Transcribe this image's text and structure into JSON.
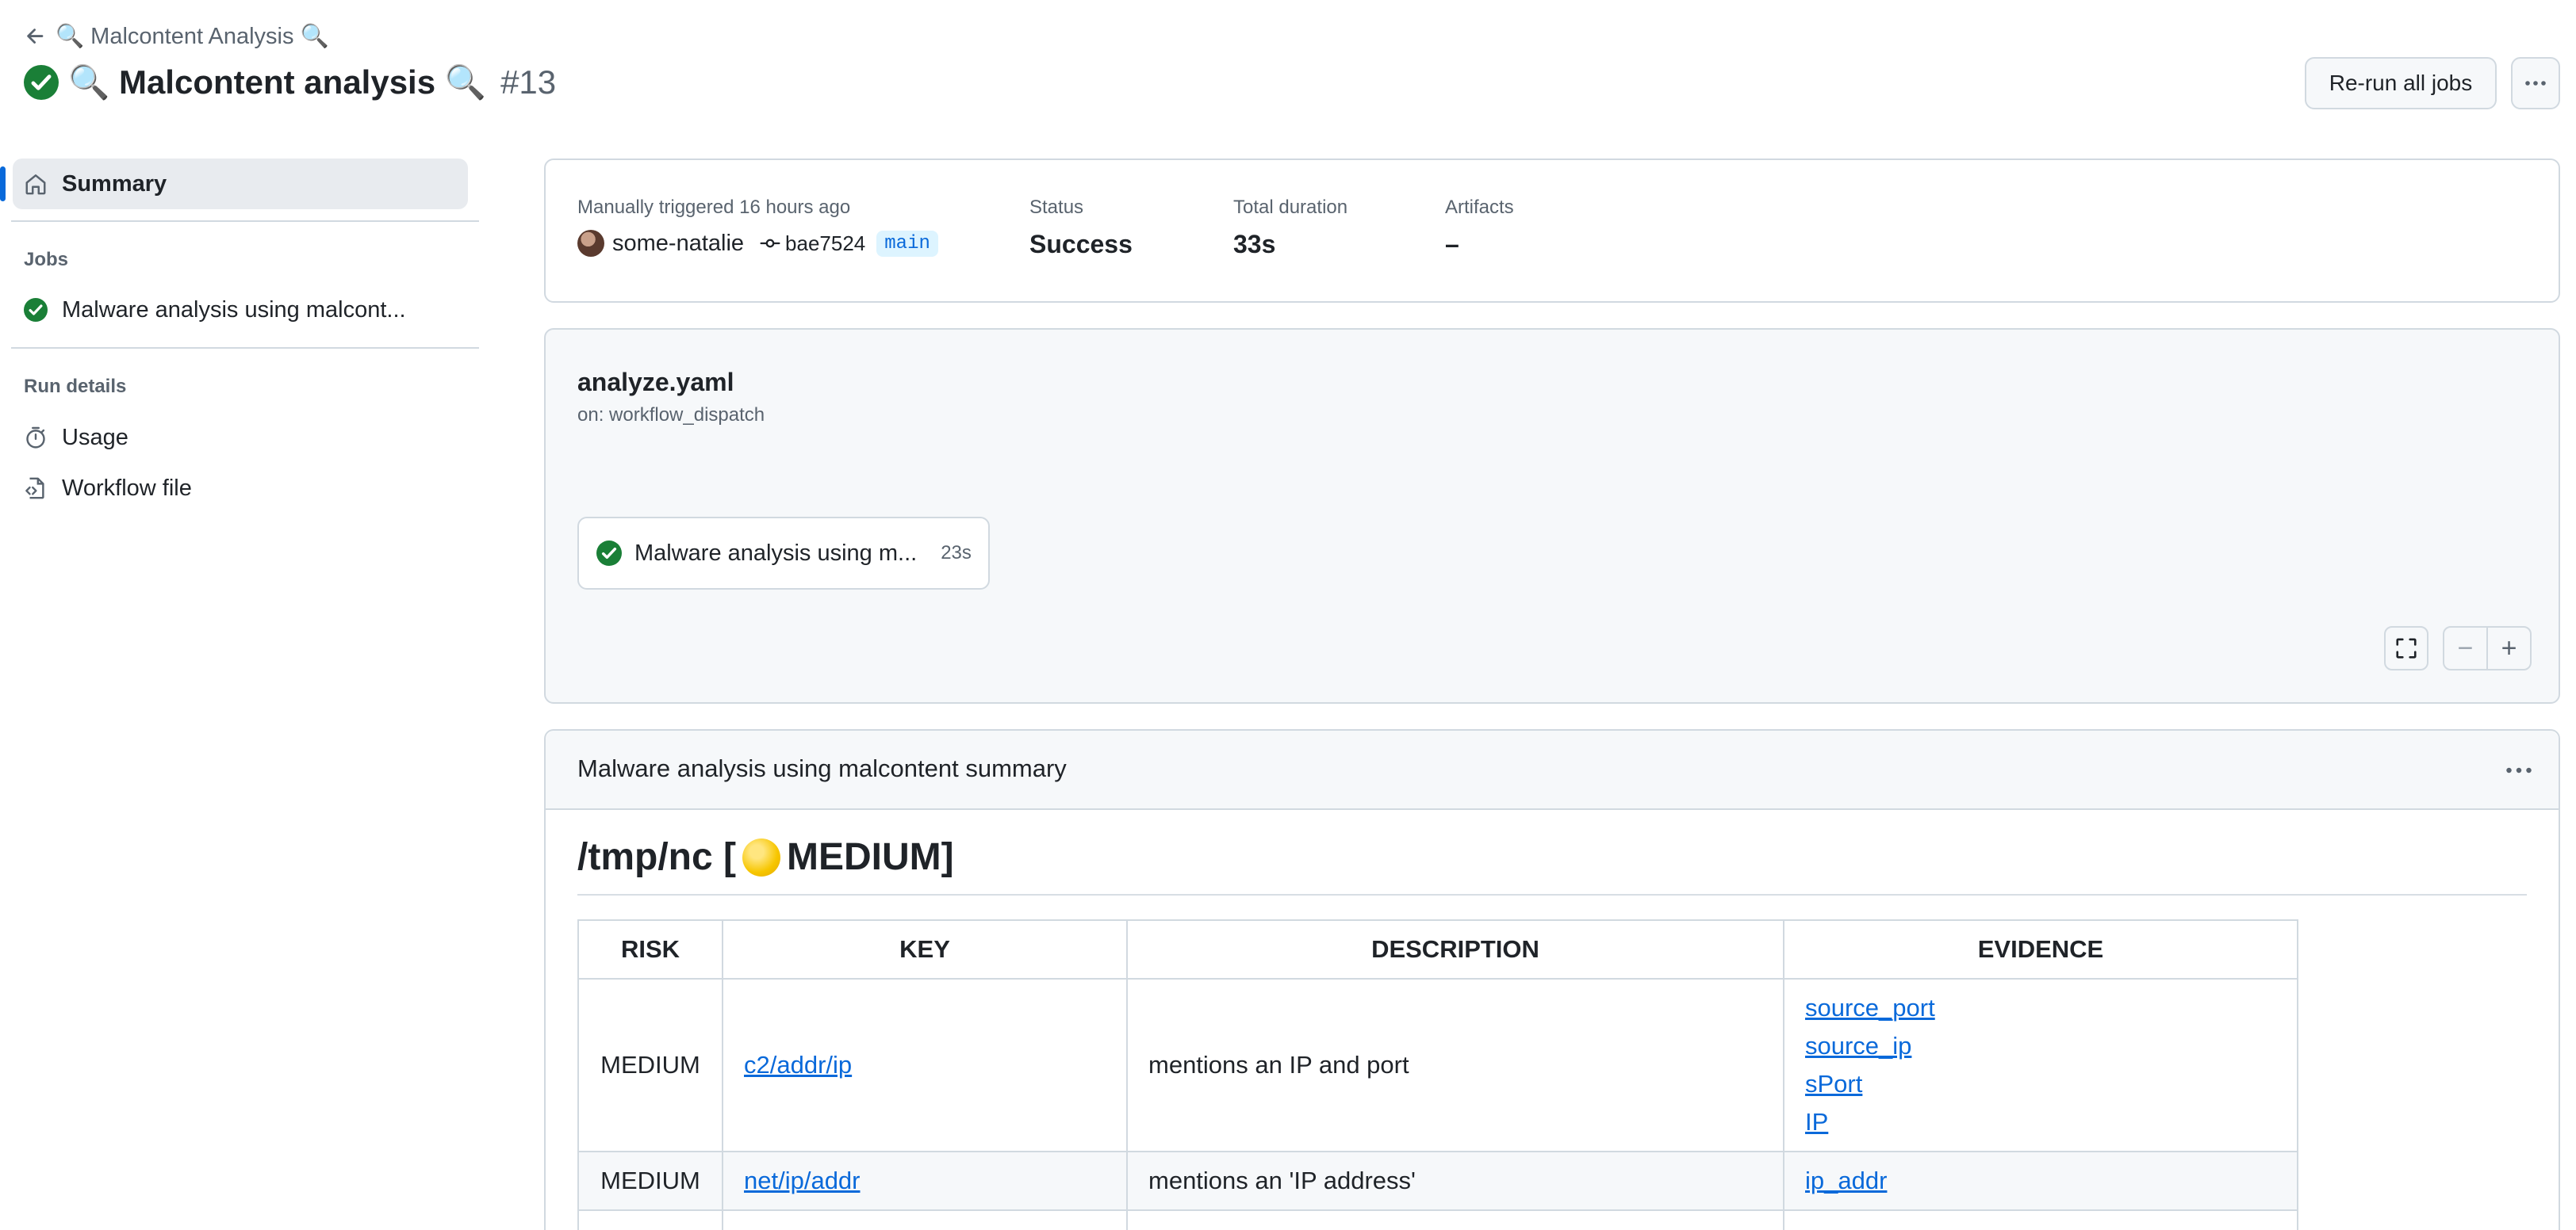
{
  "breadcrumb": {
    "back_label": "🔍 Malcontent Analysis 🔍"
  },
  "header": {
    "title": "🔍 Malcontent analysis 🔍",
    "run_number": "#13",
    "rerun_label": "Re-run all jobs"
  },
  "sidebar": {
    "summary_label": "Summary",
    "jobs_heading": "Jobs",
    "job_label": "Malware analysis using malcont...",
    "run_details_heading": "Run details",
    "usage_label": "Usage",
    "workflow_file_label": "Workflow file"
  },
  "run_info": {
    "trigger_text": "Manually triggered 16 hours ago",
    "actor": "some-natalie",
    "commit": "bae7524",
    "branch": "main",
    "status_label": "Status",
    "status_value": "Success",
    "duration_label": "Total duration",
    "duration_value": "33s",
    "artifacts_label": "Artifacts",
    "artifacts_value": "–"
  },
  "workflow": {
    "file_name": "analyze.yaml",
    "trigger": "on: workflow_dispatch",
    "job_name": "Malware analysis using m...",
    "job_duration": "23s"
  },
  "summary": {
    "title": "Malware analysis using malcontent summary",
    "file_path": "/tmp/nc [",
    "file_level": "MEDIUM]",
    "columns": [
      "RISK",
      "KEY",
      "DESCRIPTION",
      "EVIDENCE"
    ],
    "rows": [
      {
        "risk": "MEDIUM",
        "key": "c2/addr/ip",
        "description": "mentions an IP and port",
        "evidence": [
          "source_port",
          "source_ip",
          "sPort",
          "IP"
        ]
      },
      {
        "risk": "MEDIUM",
        "key": "net/ip/addr",
        "description": "mentions an 'IP address'",
        "evidence": [
          "ip_addr"
        ]
      }
    ]
  },
  "colors": {
    "accent": "#0969da",
    "success": "#1a7f37",
    "border": "#d1d9e0",
    "muted": "#59636e"
  },
  "icons": [
    "arrow-left-icon",
    "check-circle-icon",
    "home-icon",
    "stopwatch-icon",
    "file-code-icon",
    "commit-icon",
    "kebab-horizontal-icon",
    "fullscreen-icon",
    "zoom-out-icon",
    "zoom-in-icon"
  ]
}
